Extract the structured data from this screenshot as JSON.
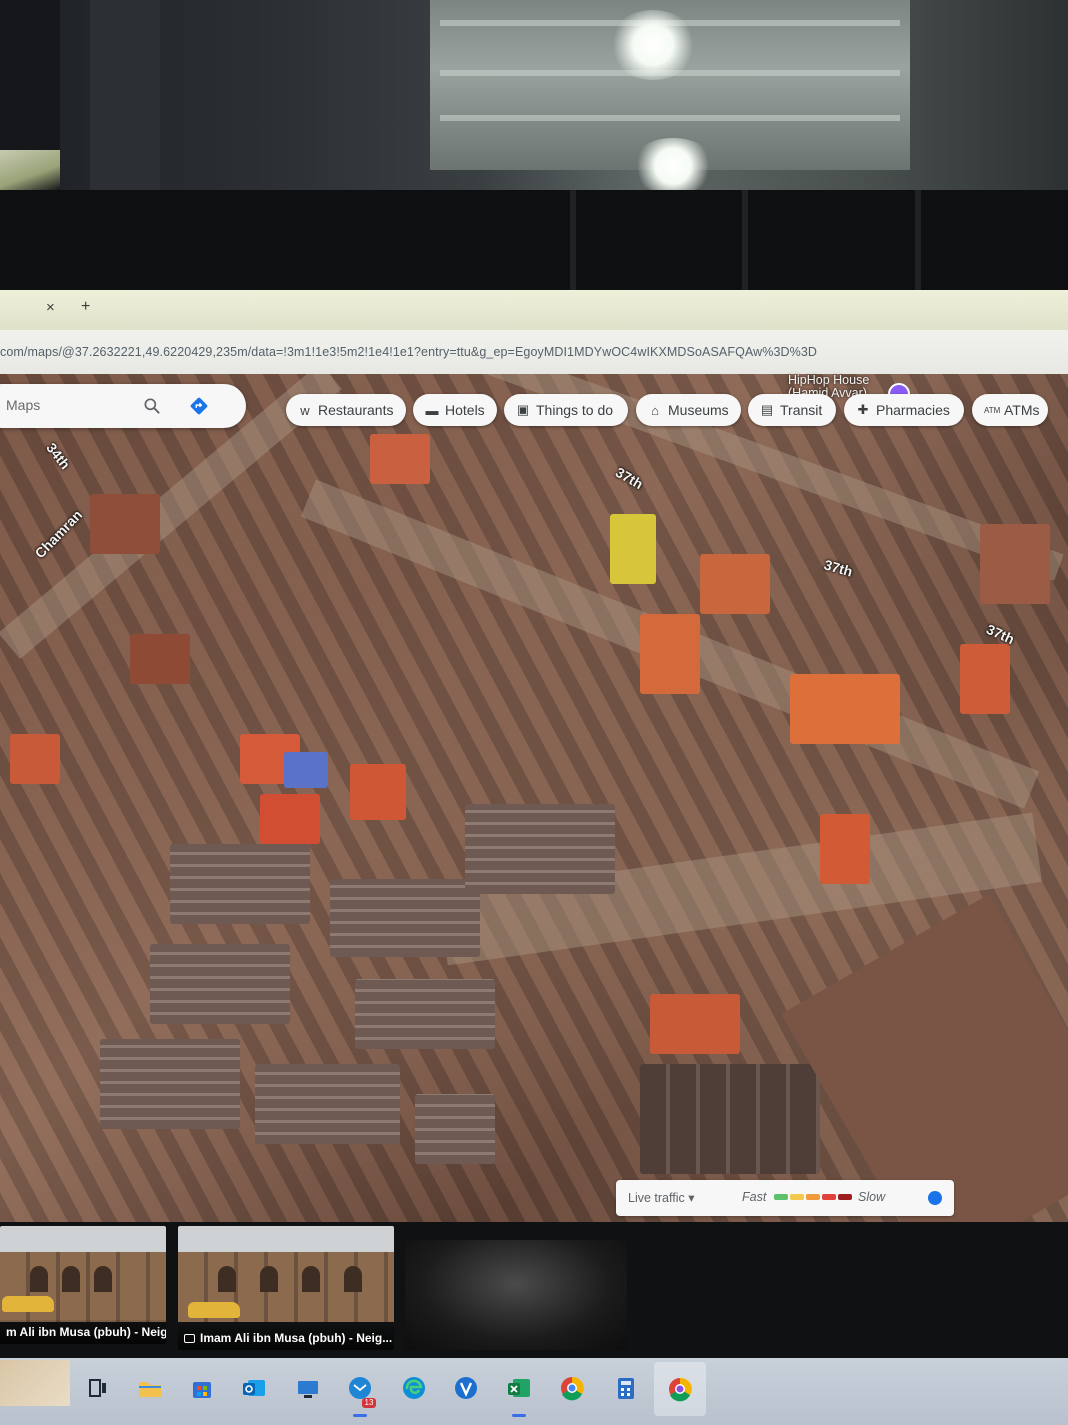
{
  "browser": {
    "tab_close": "×",
    "tab_new": "+",
    "url": "com/maps/@37.2632221,49.6220429,235m/data=!3m1!1e3!5m2!1e4!1e1?entry=ttu&g_ep=EgoyMDI1MDYwOC4wIKXMDSoASAFQAw%3D%3D"
  },
  "search": {
    "placeholder": "Maps",
    "search_icon": "search-icon",
    "directions_icon": "directions-icon"
  },
  "chips": [
    {
      "label": "Restaurants",
      "icon": "fork-knife-icon"
    },
    {
      "label": "Hotels",
      "icon": "bed-icon"
    },
    {
      "label": "Things to do",
      "icon": "camera-icon"
    },
    {
      "label": "Museums",
      "icon": "museum-icon"
    },
    {
      "label": "Transit",
      "icon": "train-icon"
    },
    {
      "label": "Pharmacies",
      "icon": "pharmacy-icon"
    },
    {
      "label": "ATMs",
      "icon": "atm-icon"
    }
  ],
  "map": {
    "poi_name": "HipHop House",
    "poi_subtitle": "(Hamid Avvar)",
    "street_labels": [
      "34th",
      "Chamran",
      "37th",
      "37th",
      "37th"
    ]
  },
  "traffic": {
    "label": "Live traffic",
    "fast": "Fast",
    "slow": "Slow",
    "colors": [
      "#5cc16a",
      "#f2c94c",
      "#f29a3a",
      "#e0423a",
      "#a01d1d"
    ]
  },
  "photos": [
    {
      "caption": "m Ali ibn Musa (pbuh) - Neig..."
    },
    {
      "caption": "Imam Ali ibn Musa (pbuh) - Neig..."
    }
  ],
  "taskbar": {
    "mail_badge": "13"
  }
}
